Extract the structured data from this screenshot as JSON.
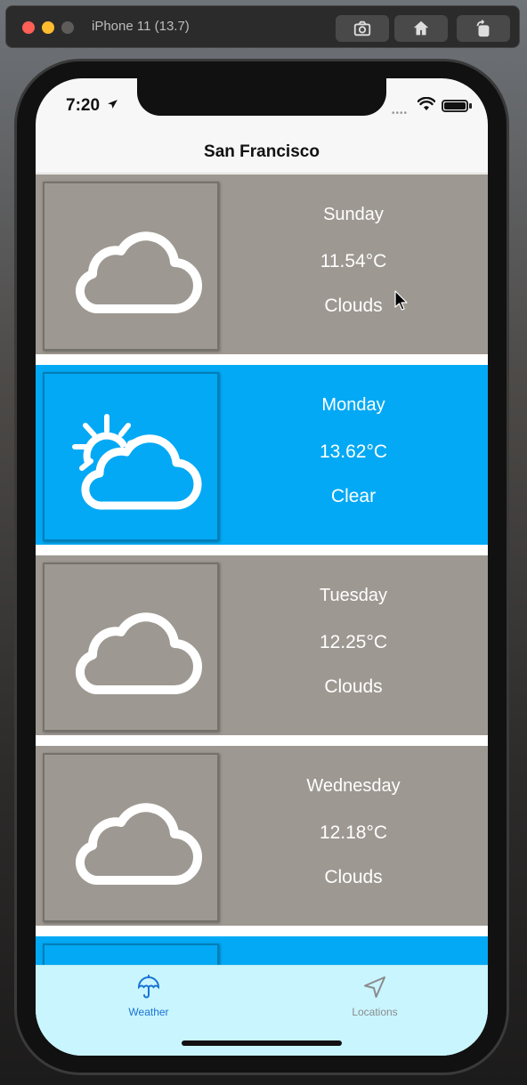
{
  "simulator": {
    "title": "iPhone 11 (13.7)",
    "buttons": [
      "screenshot-icon",
      "home-icon",
      "rotate-icon"
    ]
  },
  "status_bar": {
    "time": "7:20"
  },
  "nav": {
    "title": "San Francisco"
  },
  "forecast": [
    {
      "day": "Sunday",
      "temp": "11.54°C",
      "condition": "Clouds",
      "icon": "cloud-icon",
      "color": "#9d9891"
    },
    {
      "day": "Monday",
      "temp": "13.62°C",
      "condition": "Clear",
      "icon": "sun-cloud-icon",
      "color": "#03a9f4"
    },
    {
      "day": "Tuesday",
      "temp": "12.25°C",
      "condition": "Clouds",
      "icon": "cloud-icon",
      "color": "#9d9891"
    },
    {
      "day": "Wednesday",
      "temp": "12.18°C",
      "condition": "Clouds",
      "icon": "cloud-icon",
      "color": "#9d9891"
    }
  ],
  "tab_bar": {
    "weather_label": "Weather",
    "locations_label": "Locations",
    "active": "Weather",
    "active_color": "#1a73d4"
  }
}
